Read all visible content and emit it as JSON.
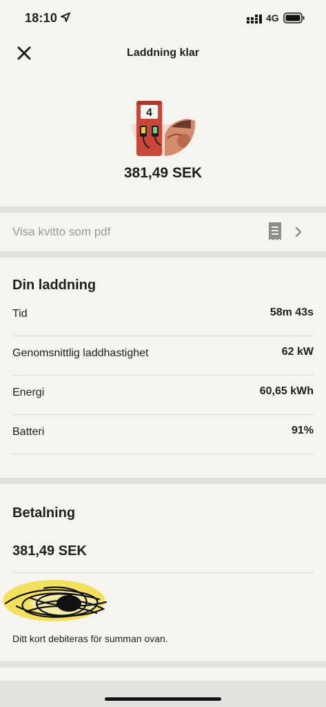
{
  "status_bar": {
    "time": "18:10",
    "network": "4G"
  },
  "nav": {
    "title": "Laddning klar"
  },
  "hero": {
    "pump_number": "4",
    "amount": "381,49 SEK"
  },
  "receipt": {
    "label": "Visa kvitto som pdf"
  },
  "charging": {
    "title": "Din laddning",
    "rows": [
      {
        "label": "Tid",
        "value": "58m 43s"
      },
      {
        "label": "Genomsnittlig laddhastighet",
        "value": "62 kW"
      },
      {
        "label": "Energi",
        "value": "60,65 kWh"
      },
      {
        "label": "Batteri",
        "value": "91%"
      }
    ]
  },
  "payment": {
    "title": "Betalning",
    "amount": "381,49 SEK",
    "note": "Ditt kort debiteras för summan ovan."
  },
  "colors": {
    "background": "#f6f4ef",
    "pump_red": "#c8473a",
    "accent_yellow": "#f2dc45"
  }
}
